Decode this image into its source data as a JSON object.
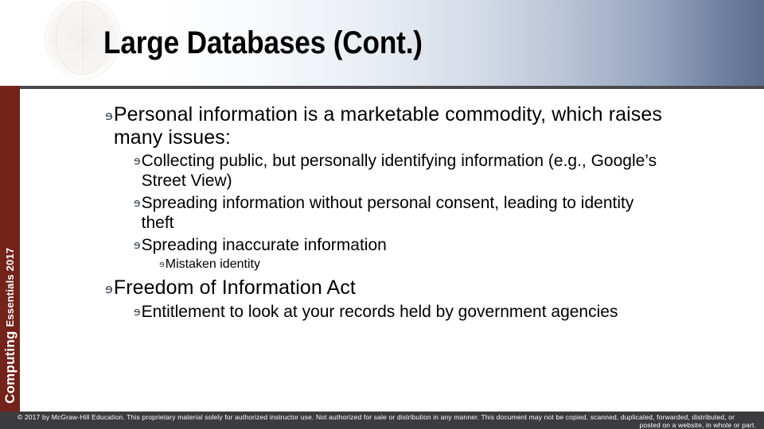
{
  "slide": {
    "title": "Large Databases (Cont.)",
    "bullet_marker": "ɘ",
    "side_label_primary": "Computing",
    "side_label_secondary": "Essentials 2017",
    "colors": {
      "side_bar": "#73231A",
      "header_rule": "#4A4A4E",
      "footer_bar": "#3C3C3F",
      "header_gradient_end": "#5D6E8C",
      "text": "#000000",
      "marker": "#2D3A4D"
    }
  },
  "content": {
    "bullets": [
      {
        "level": 1,
        "text": "Personal information is a marketable commodity, which raises many issues:"
      },
      {
        "level": 2,
        "text": "Collecting public, but personally identifying information (e.g., Google’s Street View)"
      },
      {
        "level": 2,
        "text": "Spreading information without personal consent, leading to identity theft"
      },
      {
        "level": 2,
        "text": "Spreading inaccurate information"
      },
      {
        "level": 3,
        "text": "Mistaken identity"
      },
      {
        "level": 1,
        "text": "Freedom of Information Act"
      },
      {
        "level": 2,
        "text": "Entitlement to look at your records held by government agencies"
      }
    ]
  },
  "footer": {
    "line_main": "© 2017 by McGraw-Hill Education. This proprietary material solely for authorized instructor use. Not authorized for sale or distribution in any manner. This document may not be copied, scanned, duplicated, forwarded, distributed, or",
    "line_tail": "posted on a website, in whole or part."
  }
}
